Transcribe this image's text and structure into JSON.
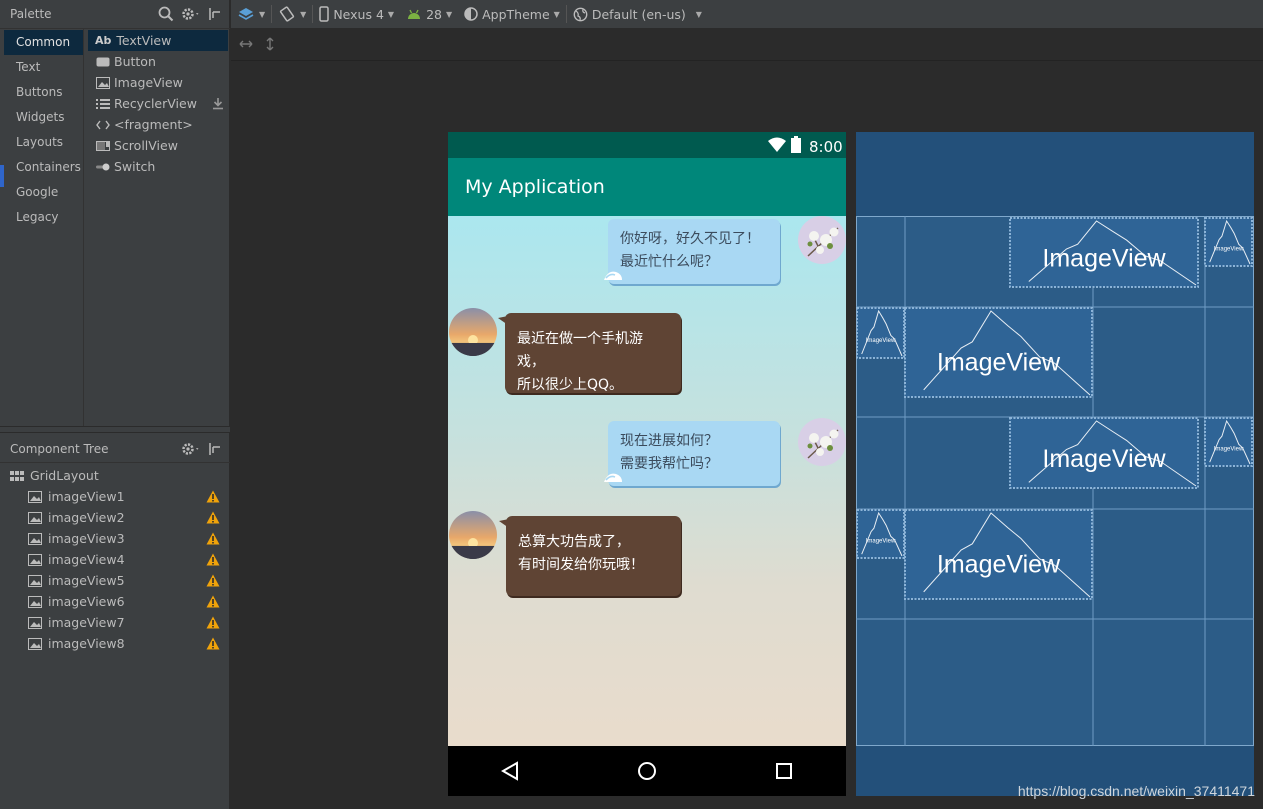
{
  "palette": {
    "title": "Palette",
    "categories": [
      "Common",
      "Text",
      "Buttons",
      "Widgets",
      "Layouts",
      "Containers",
      "Google",
      "Legacy"
    ],
    "items": [
      {
        "label": "TextView",
        "prefix": "Ab",
        "icon": "textview-icon"
      },
      {
        "label": "Button",
        "icon": "button-icon"
      },
      {
        "label": "ImageView",
        "icon": "imageview-icon"
      },
      {
        "label": "RecyclerView",
        "icon": "recyclerview-icon"
      },
      {
        "label": "<fragment>",
        "icon": "fragment-icon"
      },
      {
        "label": "ScrollView",
        "icon": "scrollview-icon"
      },
      {
        "label": "Switch",
        "icon": "switch-icon"
      }
    ]
  },
  "component_tree": {
    "title": "Component Tree",
    "root": "GridLayout",
    "children": [
      "imageView1",
      "imageView2",
      "imageView3",
      "imageView4",
      "imageView5",
      "imageView6",
      "imageView7",
      "imageView8"
    ]
  },
  "toolbar": {
    "device": "Nexus 4",
    "api": "28",
    "theme": "AppTheme",
    "locale": "Default (en-us)"
  },
  "phone": {
    "time": "8:00",
    "app_title": "My Application",
    "messages": [
      {
        "side": "right",
        "lines": [
          "你好呀，好久不见了！",
          "最近忙什么呢？"
        ]
      },
      {
        "side": "left",
        "lines": [
          "最近在做一个手机游戏，",
          "所以很少上QQ。"
        ]
      },
      {
        "side": "right",
        "lines": [
          "现在进展如何？",
          "需要我帮忙吗？"
        ]
      },
      {
        "side": "left",
        "lines": [
          "总算大功告成了，",
          "有时间发给你玩哦！"
        ]
      }
    ]
  },
  "blueprint": {
    "large_label": "ImageView",
    "small_label": "ImageView"
  },
  "watermark": "https://blog.csdn.net/weixin_37411471",
  "colors": {
    "accent": "#00877a",
    "status_bar": "#005a4f",
    "blueprint_bg": "#2c5c87",
    "warning": "#f0a30a"
  }
}
